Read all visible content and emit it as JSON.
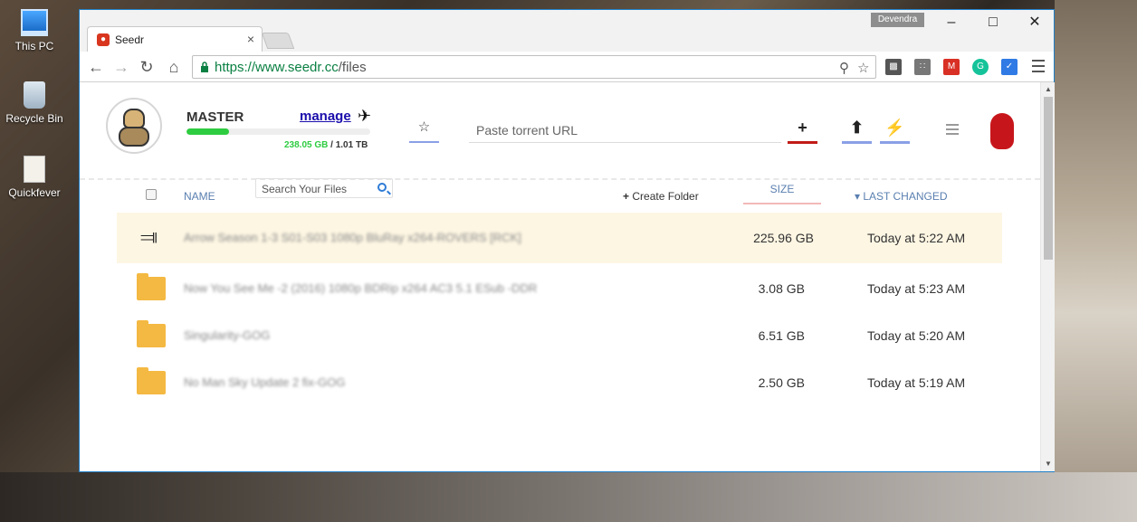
{
  "desktop": {
    "icons": [
      {
        "label": "This PC"
      },
      {
        "label": "Recycle Bin"
      },
      {
        "label": "Quickfever"
      }
    ]
  },
  "window": {
    "user": "Devendra",
    "tab_title": "Seedr",
    "url_host": "https://www.seedr.cc",
    "url_path": "/files"
  },
  "account": {
    "plan": "MASTER",
    "manage_label": "manage",
    "storage_used": "238.05 GB",
    "storage_total": "/ 1.01 TB",
    "storage_fraction": 0.23
  },
  "toolbar": {
    "torrent_placeholder": "Paste torrent URL"
  },
  "list_header": {
    "name": "NAME",
    "search_placeholder": "Search Your Files",
    "create_folder": "Create Folder",
    "size": "SIZE",
    "last_changed": "LAST CHANGED"
  },
  "files": [
    {
      "type": "share",
      "name": "Arrow Season 1-3 S01-S03 1080p BluRay x264-ROVERS [RCK]",
      "size": "225.96 GB",
      "date": "Today at 5:22 AM"
    },
    {
      "type": "folder",
      "name": "Now You See Me -2 (2016) 1080p BDRip x264 AC3 5.1 ESub -DDR",
      "size": "3.08 GB",
      "date": "Today at 5:23 AM"
    },
    {
      "type": "folder",
      "name": "Singularity-GOG",
      "size": "6.51 GB",
      "date": "Today at 5:20 AM"
    },
    {
      "type": "folder",
      "name": "No Man Sky Update 2 fix-GOG",
      "size": "2.50 GB",
      "date": "Today at 5:19 AM"
    }
  ],
  "colors": {
    "accent_blue": "#8aa0e6",
    "add_red": "#c11b17",
    "storage_green": "#2ecc40",
    "folder_yellow": "#f4b942",
    "highlight_row": "#fdf6e3"
  }
}
